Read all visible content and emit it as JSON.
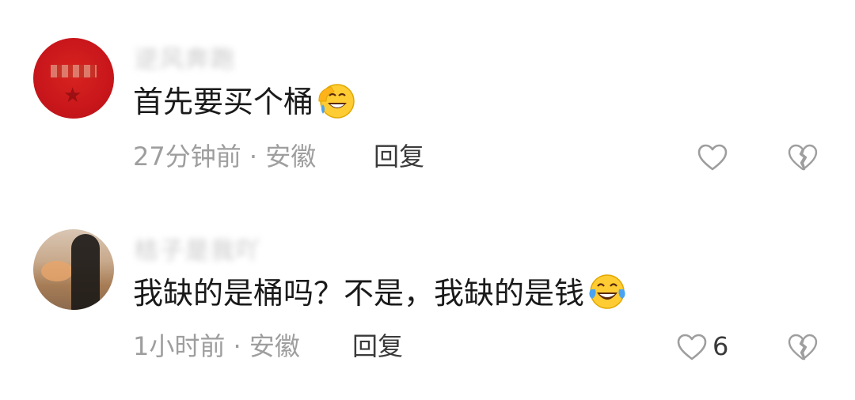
{
  "comments": [
    {
      "username": "逆风奔跑",
      "text": "首先要买个桶",
      "emoji_icon": "face-with-hand-over-laughing-icon",
      "meta": "27分钟前 · 安徽",
      "reply_label": "回复",
      "like_count": "",
      "avatar_icon": "red-badge-avatar",
      "accent_color": "#c8161b"
    },
    {
      "username": "桔子是我吖",
      "text": "我缺的是桶吗？不是，我缺的是钱",
      "emoji_icon": "face-with-tears-of-joy-icon",
      "meta": "1小时前 · 安徽",
      "reply_label": "回复",
      "like_count": "6",
      "avatar_icon": "photo-avatar"
    }
  ],
  "colors": {
    "meta_text": "#9e9e9e",
    "body_text": "#1a1a1a",
    "icon_gray": "#9e9e9e"
  }
}
